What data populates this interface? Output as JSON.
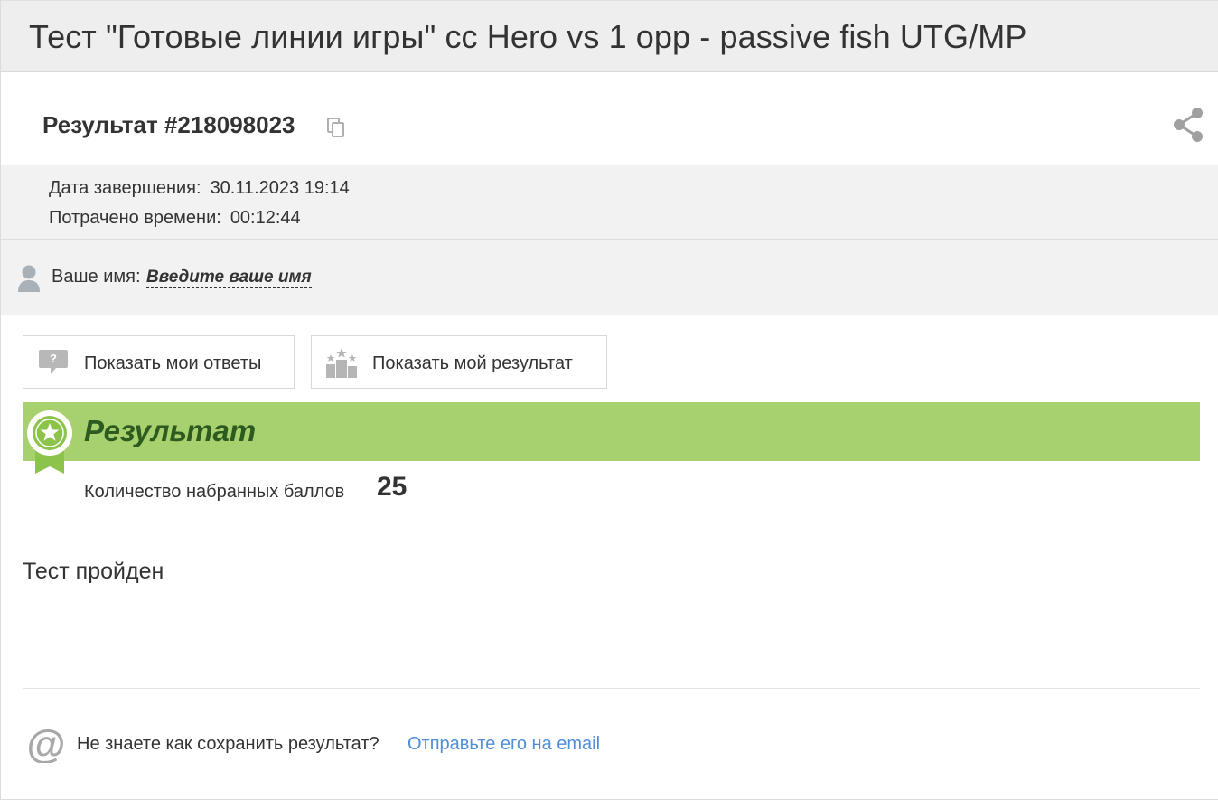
{
  "header": {
    "title": "Тест \"Готовые линии игры\" сс Hero vs 1 opp - passive fish UTG/MP"
  },
  "result": {
    "id_label": "Результат #218098023"
  },
  "meta": {
    "completion_label": "Дата завершения:",
    "completion_value": "30.11.2023 19:14",
    "time_label": "Потрачено времени:",
    "time_value": "00:12:44"
  },
  "name": {
    "label": "Ваше имя:",
    "placeholder": "Введите ваше имя"
  },
  "buttons": {
    "show_answers": "Показать мои ответы",
    "show_result": "Показать мой результат"
  },
  "score": {
    "heading": "Результат",
    "label": "Количество набранных баллов",
    "value": "25"
  },
  "status": {
    "text": "Тест пройден"
  },
  "footer": {
    "question": "Не знаете как сохранить результат?",
    "link": "Отправьте его на email"
  },
  "icons": {
    "copy": "copy-icon",
    "share": "share-icon",
    "user": "user-icon",
    "question": "question-bubble-icon",
    "podium": "podium-icon",
    "badge": "award-badge-icon",
    "email": "at-icon"
  },
  "colors": {
    "banner": "#a7d16e",
    "banner_text": "#2d5a1e",
    "link": "#4f8ed8",
    "icon_grey": "#a0a0a0"
  }
}
